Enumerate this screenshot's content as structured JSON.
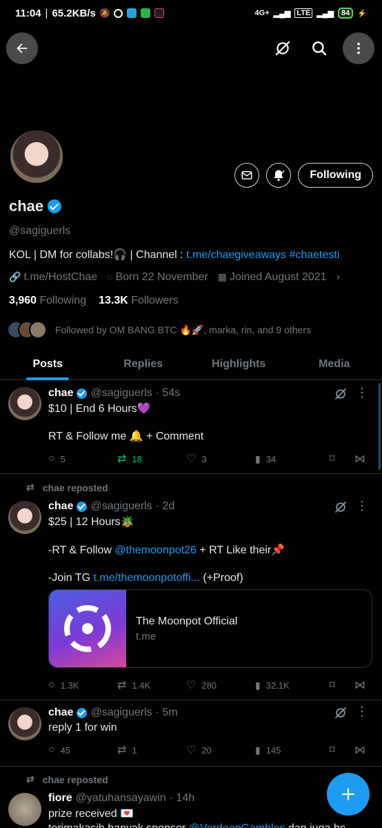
{
  "status": {
    "time": "11:04",
    "speed": "65.2KB/s",
    "battery": "84",
    "network": "4G+"
  },
  "profile": {
    "name": "chae",
    "handle": "@sagiguerls",
    "bio_text": "KOL | DM for collabs!🎧 | Channel : ",
    "bio_link": "t.me/chaegiveaways",
    "bio_tag": "#chaetesti",
    "website": "t.me/HostChae",
    "born": "Born 22 November",
    "joined": "Joined August 2021",
    "following_count": "3,960",
    "following_label": "Following",
    "followers_count": "13.3K",
    "followers_label": "Followers",
    "followed_by": "Followed by OM BANG BTC 🔥🚀, marka, rin, and 9 others",
    "follow_button": "Following"
  },
  "tabs": [
    "Posts",
    "Replies",
    "Highlights",
    "Media"
  ],
  "posts": [
    {
      "name": "chae",
      "handle": "@sagiguerls",
      "time": "· 54s",
      "line1": "$10 | End 6 Hours💜",
      "line2": "RT & Follow me 🔔 + Comment",
      "replies": "5",
      "reposts": "18",
      "likes": "3",
      "views": "34"
    },
    {
      "repost_label": "chae reposted",
      "name": "chae",
      "handle": "@sagiguerls",
      "time": "· 2d",
      "line1": "$25 | 12 Hours🪴",
      "line2_pre": "-RT & Follow ",
      "line2_link": "@themoonpot26",
      "line2_post": " + RT Like their📌",
      "line3_pre": "-Join TG ",
      "line3_link": "t.me/themoonpotoffi...",
      "line3_post": " (+Proof)",
      "card_title": "The Moonpot Official",
      "card_domain": "t.me",
      "replies": "1.3K",
      "reposts": "1.4K",
      "likes": "280",
      "views": "32.1K"
    },
    {
      "name": "chae",
      "handle": "@sagiguerls",
      "time": "· 5m",
      "line1": "reply 1 for win",
      "replies": "45",
      "reposts": "1",
      "likes": "20",
      "views": "145"
    },
    {
      "repost_label": "chae reposted",
      "name": "fiore",
      "handle": "@yatuhansayawin",
      "time": "· 14h",
      "line1": "prize received 💌",
      "line2_pre": "terimakasih banyak sponsor ",
      "line2_link": "@VerdeenGambles",
      "line2_post": " dan juga host"
    }
  ]
}
